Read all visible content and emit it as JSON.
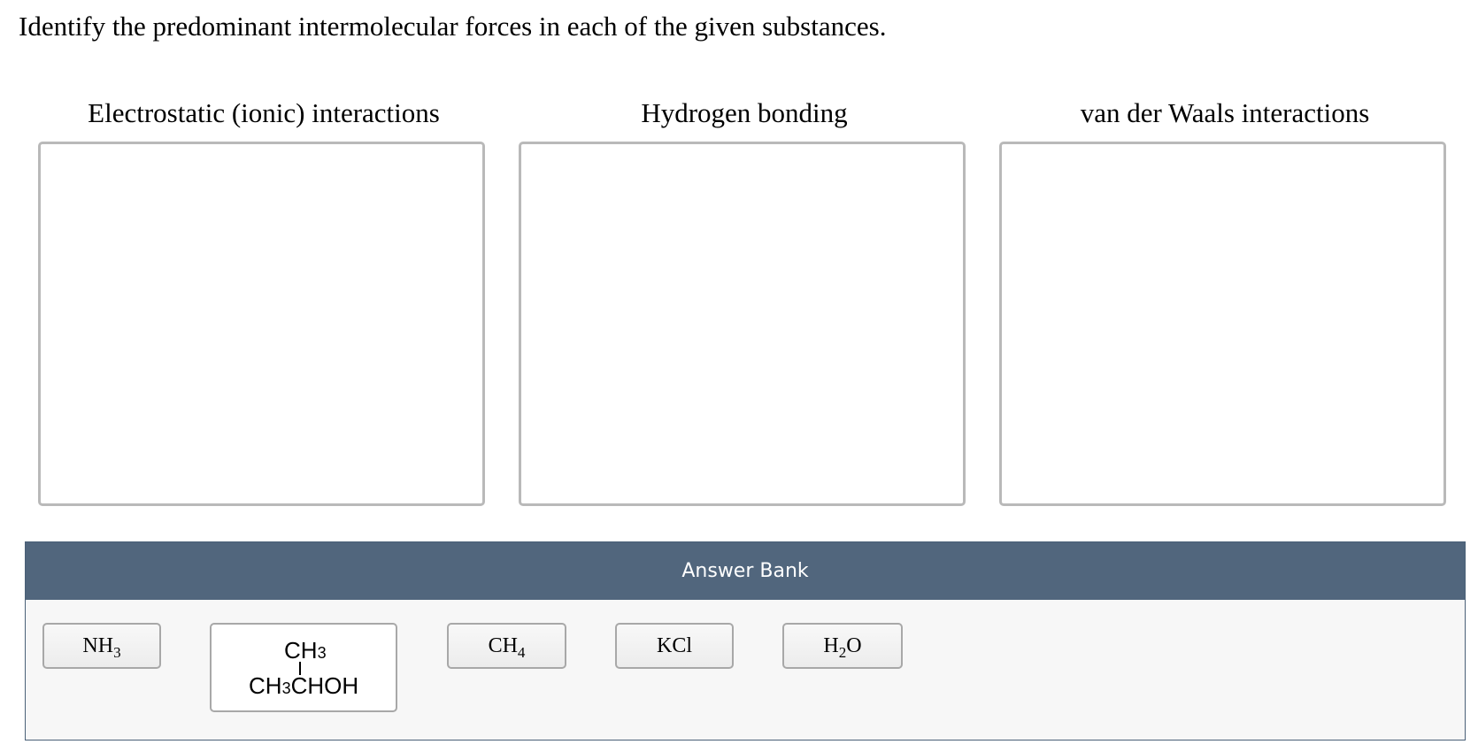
{
  "question": {
    "prompt": "Identify the predominant intermolecular forces in each of the given substances."
  },
  "bins": [
    {
      "label": "Electrostatic (ionic) interactions"
    },
    {
      "label": "Hydrogen bonding"
    },
    {
      "label": "van der Waals interactions"
    }
  ],
  "answer_bank": {
    "title": "Answer Bank",
    "items": [
      {
        "base": "NH",
        "sub": "3",
        "tail": ""
      },
      {
        "structure_top": "CH",
        "structure_top_sub": "3",
        "structure_bottom_a": "CH",
        "structure_bottom_sub": "3",
        "structure_bottom_b": "CHOH"
      },
      {
        "base": "CH",
        "sub": "4",
        "tail": ""
      },
      {
        "base": "KCl",
        "sub": "",
        "tail": ""
      },
      {
        "base": "H",
        "sub": "2",
        "tail": "O"
      }
    ]
  }
}
